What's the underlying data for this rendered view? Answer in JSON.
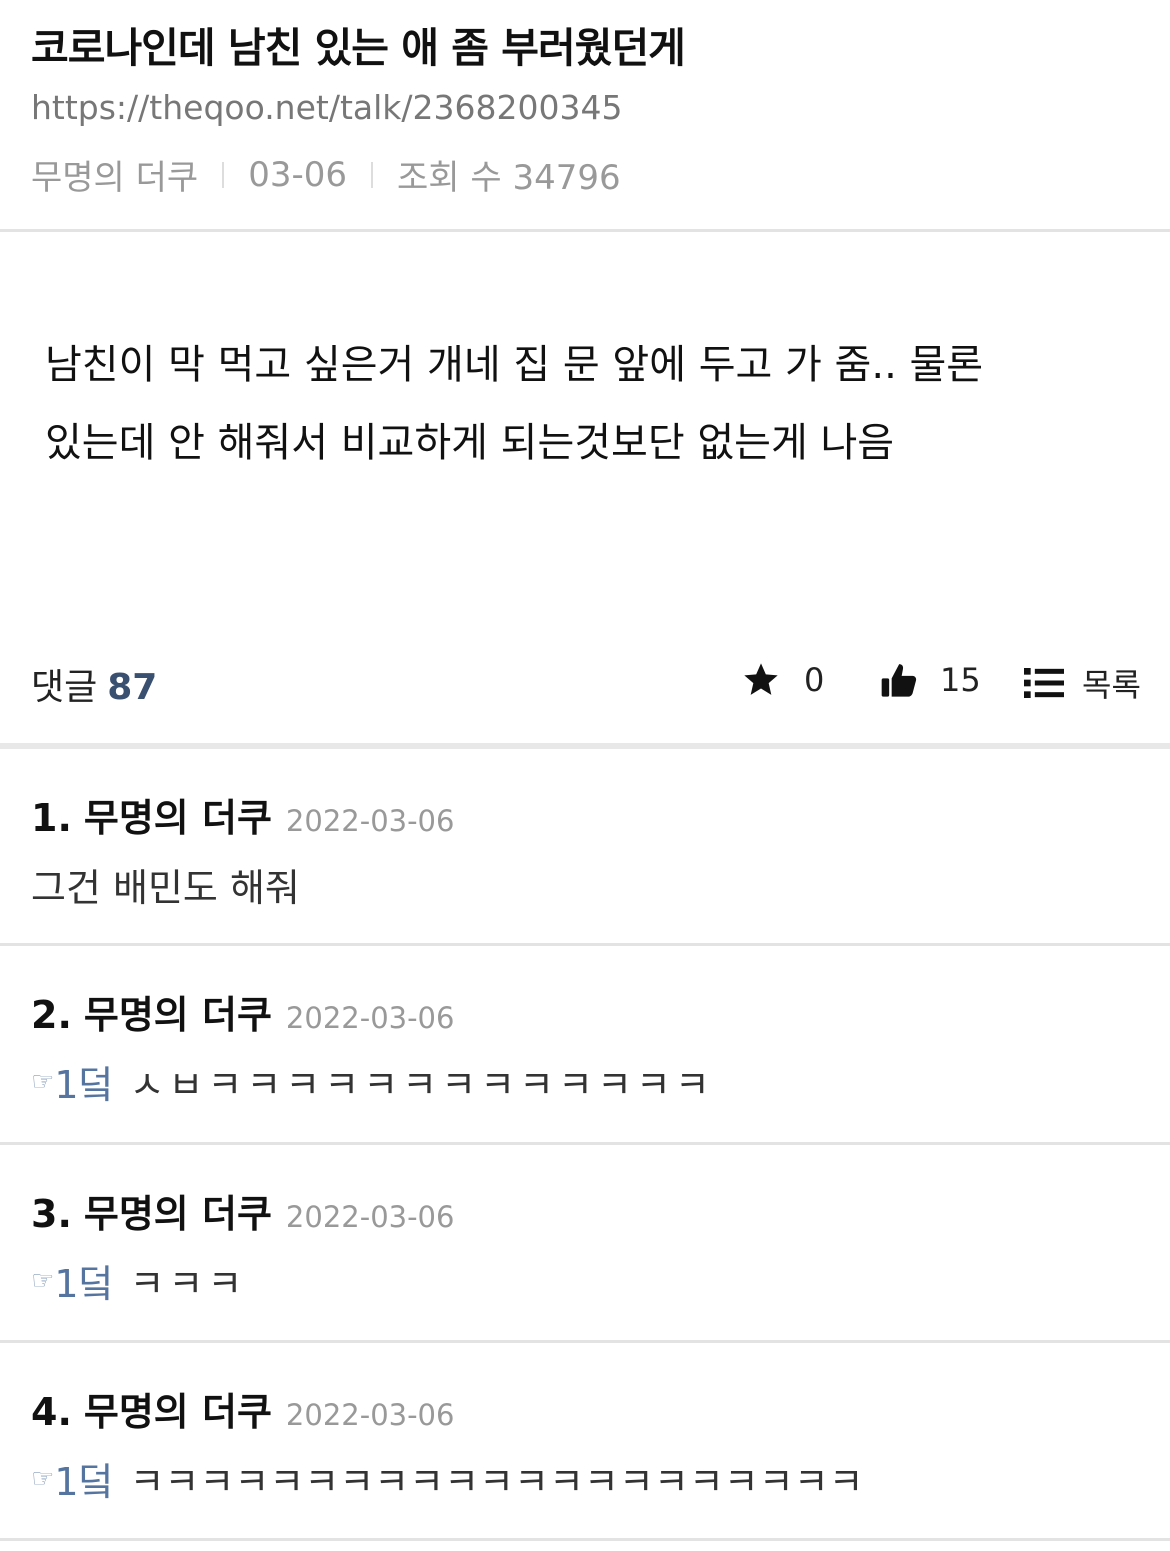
{
  "post": {
    "title": "코로나인데 남친 있는 애 좀 부러웠던게",
    "url": "https://theqoo.net/talk/2368200345",
    "author": "무명의 더쿠",
    "date": "03-06",
    "views": "조회 수 34796",
    "body_line1": "남친이 막 먹고 싶은거 개네 집 문 앞에 두고 가 줌.. 물론",
    "body_line2": "있는데 안 해줘서 비교하게 되는것보단 없는게 나음"
  },
  "stats": {
    "comments_label": "댓글",
    "comments_count": "87",
    "stars": "0",
    "likes": "15",
    "list_label": "목록",
    "icons": [
      "star-icon",
      "thumbs-up-icon",
      "list-icon"
    ]
  },
  "comments": [
    {
      "num": "1.",
      "author": "무명의 더쿠",
      "date": "2022-03-06",
      "reply_to": "",
      "text": "그건 배민도 해줘"
    },
    {
      "num": "2.",
      "author": "무명의 더쿠",
      "date": "2022-03-06",
      "reply_icon": "☞",
      "reply_to": "1덬",
      "text": "ㅅㅂㅋㅋㅋㅋㅋㅋㅋㅋㅋㅋㅋㅋㅋ"
    },
    {
      "num": "3.",
      "author": "무명의 더쿠",
      "date": "2022-03-06",
      "reply_icon": "☞",
      "reply_to": "1덬",
      "text": "ㅋㅋㅋ"
    },
    {
      "num": "4.",
      "author": "무명의 더쿠",
      "date": "2022-03-06",
      "reply_icon": "☞",
      "reply_to": "1덬",
      "text": "ㅋㅋㅋㅋㅋㅋㅋㅋㅋㅋㅋㅋㅋㅋㅋㅋㅋㅋㅋㅋㅋ"
    }
  ]
}
